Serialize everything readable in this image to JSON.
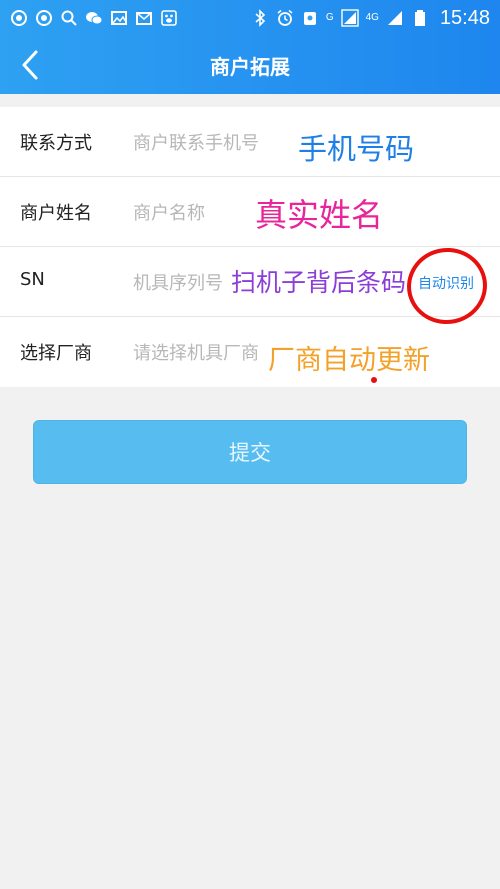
{
  "status": {
    "time": "15:48",
    "net_g": "G",
    "net_4g": "4G",
    "left_icons": [
      "notification-icon",
      "notification-icon",
      "search-icon",
      "wechat-icon",
      "image-icon",
      "mail-icon",
      "paw-icon"
    ],
    "right_icons": [
      "bluetooth-icon",
      "alarm-icon",
      "shield-icon",
      "signal-icon",
      "battery-icon"
    ]
  },
  "nav": {
    "title": "商户拓展",
    "back_icon": "chevron-left-icon"
  },
  "form": {
    "rows": [
      {
        "label": "联系方式",
        "placeholder": "商户联系手机号",
        "annotation": "手机号码",
        "annotation_color": "#1e7fe6"
      },
      {
        "label": "商户姓名",
        "placeholder": "商户名称",
        "annotation": "真实姓名",
        "annotation_color": "#e8259a"
      },
      {
        "label": "SN",
        "placeholder": "机具序列号",
        "annotation": "扫机子背后条码",
        "annotation_color": "#8b3fd8",
        "action": "自动识别"
      },
      {
        "label": "选择厂商",
        "placeholder": "请选择机具厂商",
        "annotation": "厂商自动更新",
        "annotation_color": "#f4a12a"
      }
    ]
  },
  "submit_label": "提交",
  "colors": {
    "header": "#1e86ee",
    "submit": "#57bdf0",
    "circle": "#e8100e"
  }
}
